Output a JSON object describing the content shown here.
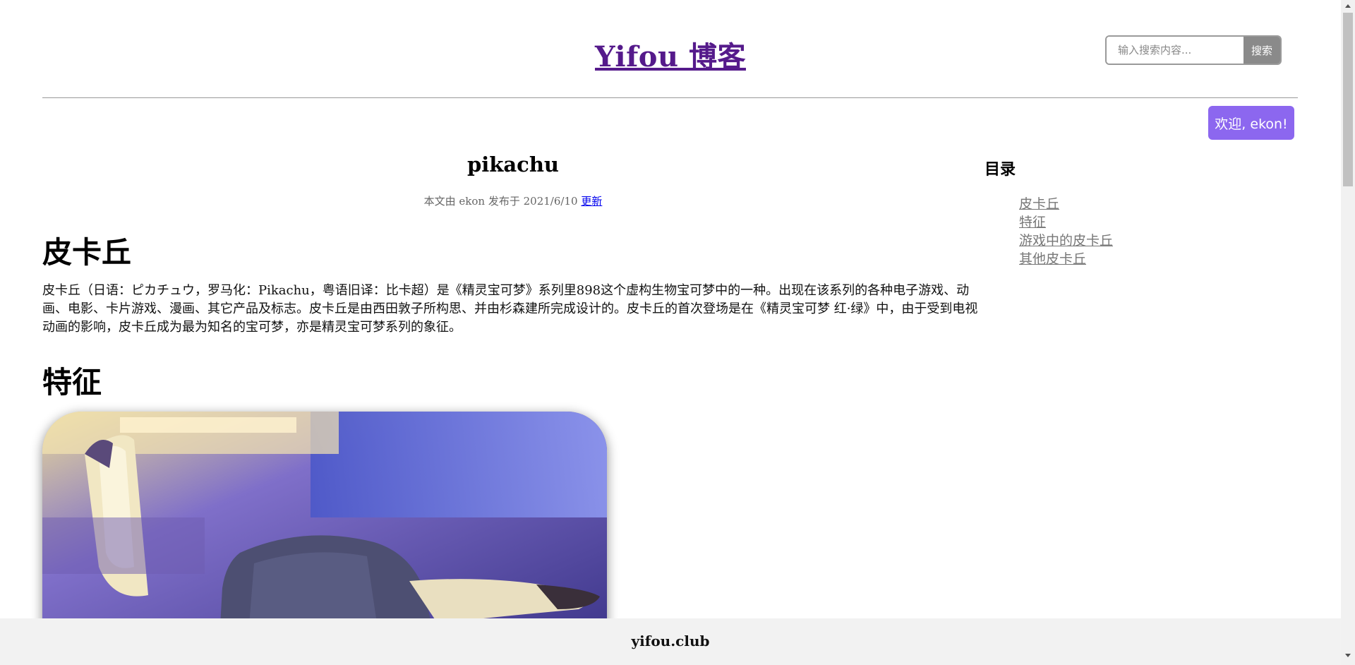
{
  "header": {
    "site_title": "Yifou 博客",
    "search_placeholder": "输入搜索内容...",
    "search_button": "搜索",
    "welcome": "欢迎, ekon!"
  },
  "post": {
    "title": "pikachu",
    "meta_prefix": "本文由 ekon 发布于 2021/6/10",
    "update_link": "更新",
    "sections": [
      {
        "heading": "皮卡丘",
        "body": "皮卡丘（日语：ピカチュウ，罗马化：Pikachu，粤语旧译：比卡超）是《精灵宝可梦》系列里898这个虚构生物宝可梦中的一种。出现在该系列的各种电子游戏、动画、电影、卡片游戏、漫画、其它产品及标志。皮卡丘是由西田敦子所构思、并由杉森建所完成设计的。皮卡丘的首次登场是在《精灵宝可梦 红·绿》中，由于受到电视动画的影响，皮卡丘成为最为知名的宝可梦，亦是精灵宝可梦系列的象征。"
      },
      {
        "heading": "特征"
      }
    ]
  },
  "toc": {
    "title": "目录",
    "items": [
      "皮卡丘",
      "特征",
      "游戏中的皮卡丘",
      "其他皮卡丘"
    ]
  },
  "footer": {
    "text": "yifou.club"
  },
  "colors": {
    "welcome_bg": "#8c67ef",
    "site_title": "#551a8b",
    "link": "#0000ee"
  }
}
